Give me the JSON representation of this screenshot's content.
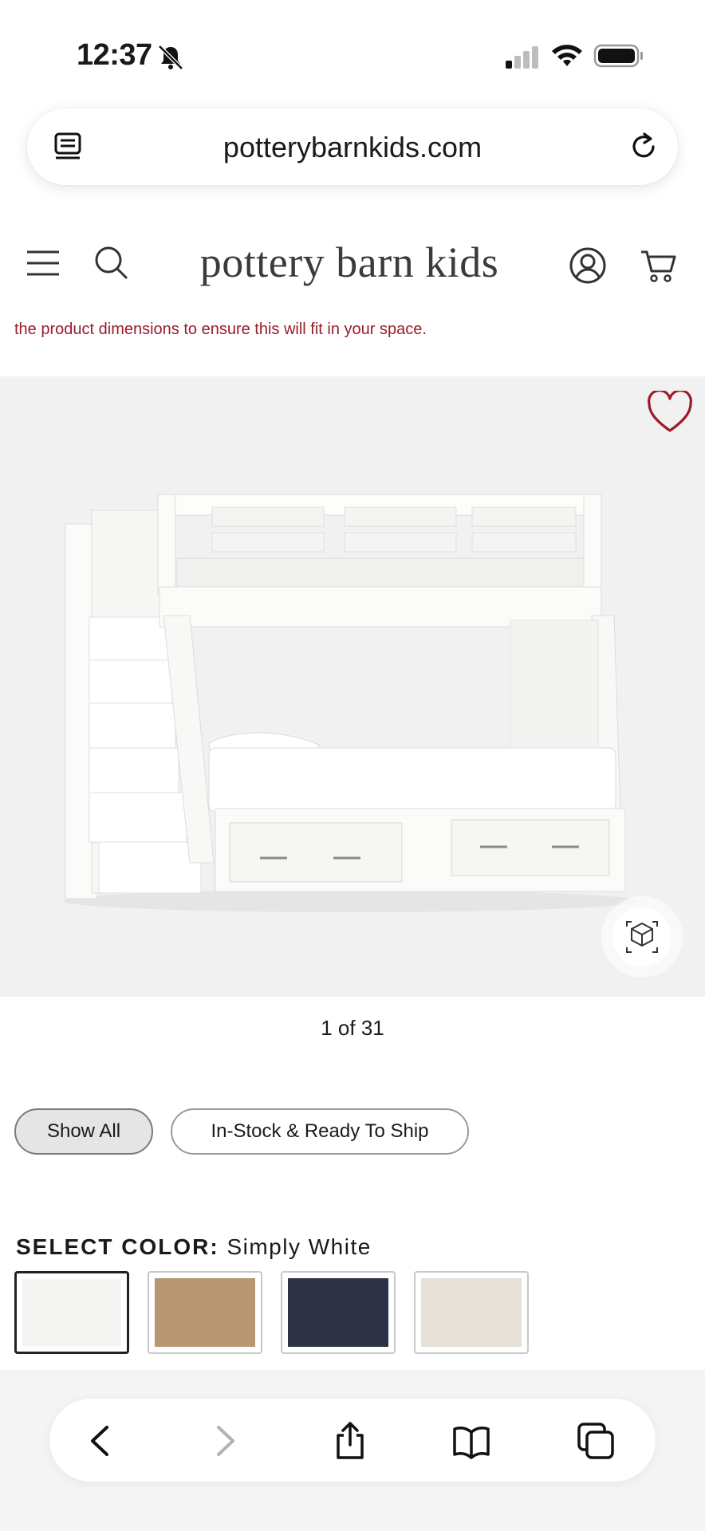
{
  "status_bar": {
    "time": "12:37"
  },
  "browser": {
    "url": "potterybarnkids.com"
  },
  "site": {
    "logo": "pottery barn kids",
    "notice": "the product dimensions to ensure this will fit in your space."
  },
  "gallery": {
    "pager": "1 of 31"
  },
  "filters": {
    "show_all": "Show All",
    "in_stock": "In-Stock & Ready To Ship"
  },
  "color": {
    "label": "SELECT COLOR:",
    "selected": "Simply White",
    "swatches": [
      {
        "name": "Simply White",
        "hex": "#f4f4f2"
      },
      {
        "name": "Natural Oak",
        "hex": "#b89672"
      },
      {
        "name": "Navy",
        "hex": "#2d3344"
      },
      {
        "name": "Weathered White",
        "hex": "#e6e0d6"
      }
    ]
  },
  "colors": {
    "accent": "#9b1b2a"
  }
}
